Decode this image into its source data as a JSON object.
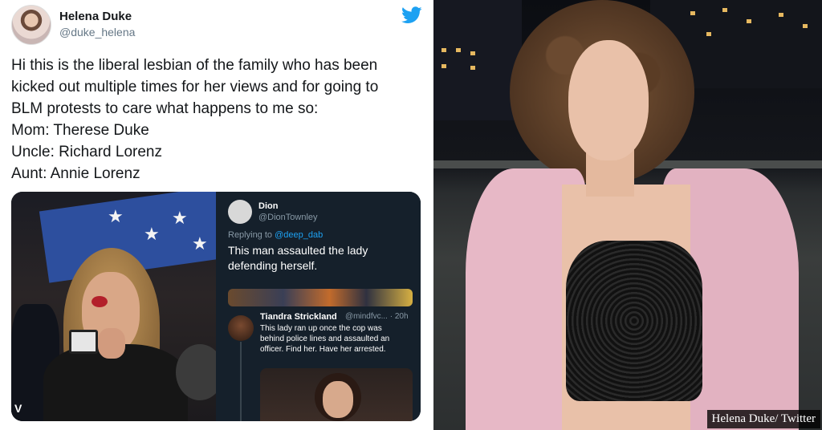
{
  "tweet": {
    "author_name": "Helena Duke",
    "author_handle": "@duke_helena",
    "lines": [
      "Hi this is the liberal lesbian of the family who has been",
      "kicked out multiple times for her views and for going to",
      "BLM protests to care what happens to me so:",
      "Mom: Therese Duke",
      "Uncle: Richard Lorenz",
      "Aunt: Annie Lorenz"
    ]
  },
  "embedded": {
    "photo_watermark": "V",
    "card1": {
      "name": "Dion",
      "handle": "@DionTownley",
      "reply_prefix": "Replying to",
      "reply_to": "@deep_dab",
      "text_line1": "This man assaulted the lady",
      "text_line2": "defending herself."
    },
    "card2": {
      "name": "Tiandra Strickland",
      "handle": "@mindfvc... · 20h",
      "lines": [
        "This lady ran up once the cop was",
        "behind police lines and assaulted an",
        "officer. Find her. Have her arrested."
      ]
    }
  },
  "photo": {
    "caption": "Helena Duke/ Twitter"
  },
  "colors": {
    "twitter_blue": "#1da1f2",
    "dark_card": "#15202b"
  },
  "icons": {
    "brand": "twitter-bird-icon"
  }
}
